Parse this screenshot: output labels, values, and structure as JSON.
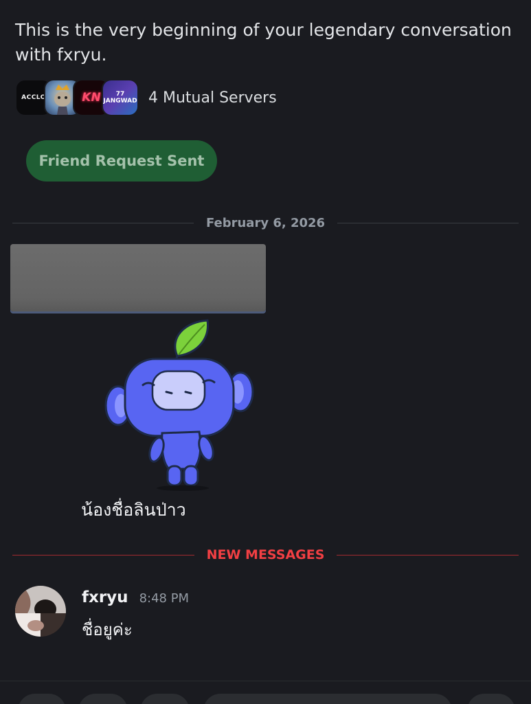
{
  "intro": {
    "text": "This is the very beginning of your legendary conversation with fxryu."
  },
  "mutual_servers": {
    "label": "4 Mutual Servers",
    "servers": [
      {
        "name": "ACCLO",
        "icon": "server-icon-acclo"
      },
      {
        "name": "",
        "icon": "server-icon-king-cat"
      },
      {
        "name": "KN",
        "icon": "server-icon-kn"
      },
      {
        "name": "77 JANGWAD",
        "icon": "server-icon-77-jangwad"
      }
    ]
  },
  "friend_request": {
    "label": "Friend Request Sent"
  },
  "date_divider": {
    "label": "February 6, 2026"
  },
  "sticker": {
    "name": "wumpus-sticker",
    "caption": "น้องชื่อลินป่าว"
  },
  "new_messages": {
    "label": "NEW MESSAGES"
  },
  "message": {
    "username": "fxryu",
    "timestamp": "8:48 PM",
    "text": "ชื่อยูค่ะ"
  },
  "colors": {
    "background": "#1a1b20",
    "friend_button_bg": "#1f5e34",
    "new_messages_red": "#f23f43",
    "wumpus_blue": "#5865f2"
  }
}
